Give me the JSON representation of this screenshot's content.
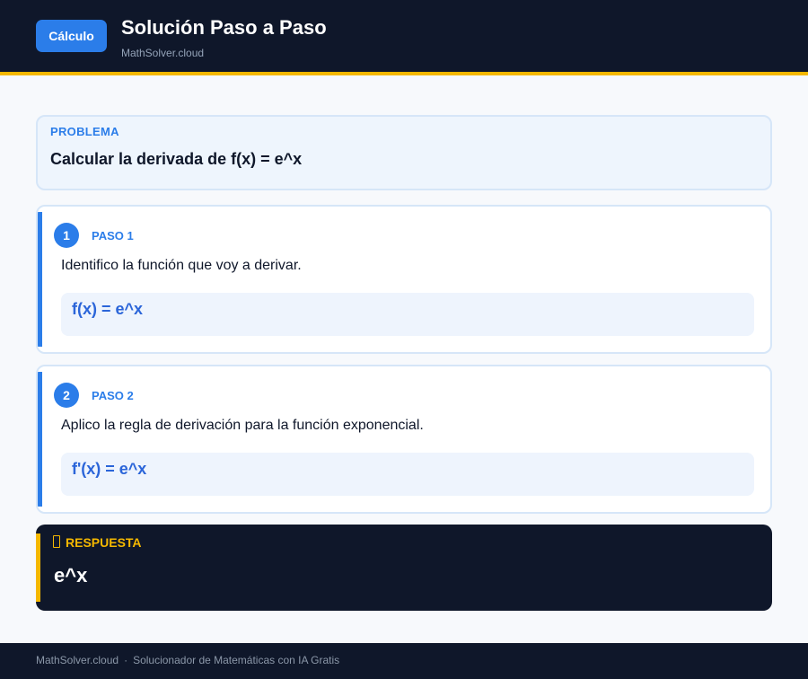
{
  "header": {
    "badge": "Cálculo",
    "title": "Solución Paso a Paso",
    "subtitle": "MathSolver.cloud"
  },
  "problem": {
    "label": "PROBLEMA",
    "text": "Calcular la derivada de f(x) = e^x"
  },
  "steps": [
    {
      "number": "1",
      "label": "PASO 1",
      "description": "Identifico la función que voy a derivar.",
      "formula": "f(x) = e^x"
    },
    {
      "number": "2",
      "label": "PASO 2",
      "description": "Aplico la regla de derivación para la función exponencial.",
      "formula": "f'(x) = e^x"
    }
  ],
  "answer": {
    "icon": "clipboard-icon",
    "label": "RESPUESTA",
    "value": "e^x"
  },
  "footer": {
    "site": "MathSolver.cloud",
    "separator": "·",
    "tagline": "Solucionador de Matemáticas con IA Gratis"
  },
  "colors": {
    "primary": "#2b7de9",
    "dark": "#0f172a",
    "accent": "#f5b800"
  }
}
